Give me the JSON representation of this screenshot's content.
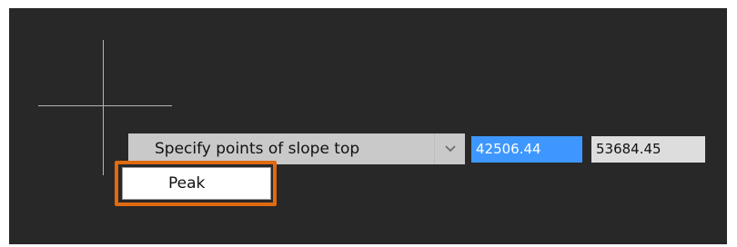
{
  "command_prompt": {
    "label": "Specify points of slope top",
    "arrow_icon": "chevron-down-icon"
  },
  "coordinates": {
    "x": "42506.44",
    "y": "53684.45"
  },
  "options": [
    {
      "label": "Peak",
      "highlighted": true
    }
  ],
  "colors": {
    "canvas": "#282828",
    "prompt_background": "#c9c9c9",
    "active_field": "#3e97ff",
    "inactive_field": "#dddddd",
    "highlight": "#e06a10",
    "crosshair": "#b6b6b6"
  }
}
